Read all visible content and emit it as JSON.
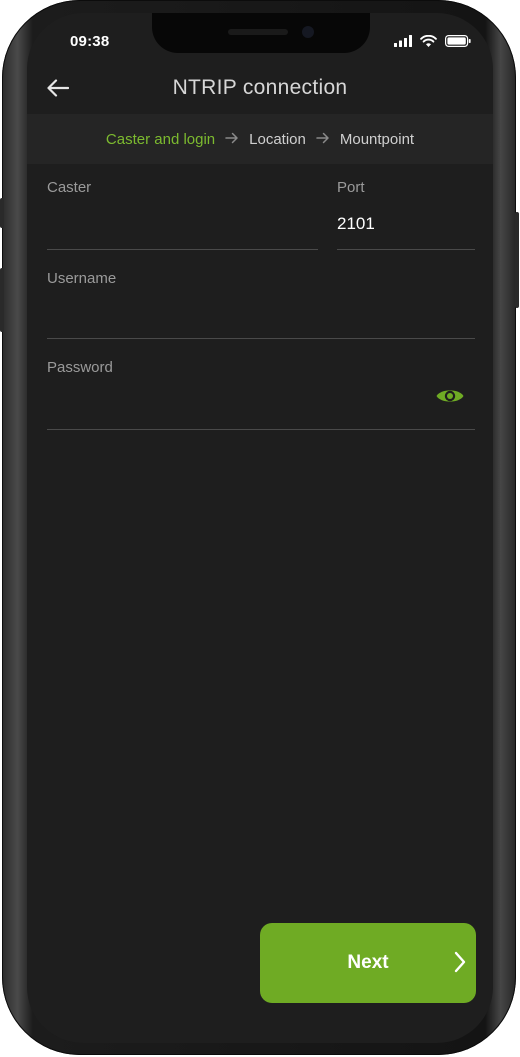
{
  "status_bar": {
    "time": "09:38",
    "icons": [
      "signal-icon",
      "wifi-icon",
      "battery-icon"
    ]
  },
  "header": {
    "title": "NTRIP connection",
    "back_icon": "arrow-left-icon"
  },
  "stepper": {
    "steps": [
      {
        "label": "Caster and login",
        "active": true
      },
      {
        "label": "Location",
        "active": false
      },
      {
        "label": "Mountpoint",
        "active": false
      }
    ],
    "separator_icon": "arrow-right-icon"
  },
  "form": {
    "caster": {
      "label": "Caster",
      "value": ""
    },
    "port": {
      "label": "Port",
      "value": "2101"
    },
    "username": {
      "label": "Username",
      "value": ""
    },
    "password": {
      "label": "Password",
      "value": "",
      "toggle_icon": "eye-icon"
    }
  },
  "footer": {
    "next_label": "Next",
    "next_icon": "chevron-right-icon"
  },
  "colors": {
    "accent": "#6fab24",
    "active_step": "#7cba2f",
    "background": "#1e1e1e",
    "stepper_bg": "#252525"
  }
}
